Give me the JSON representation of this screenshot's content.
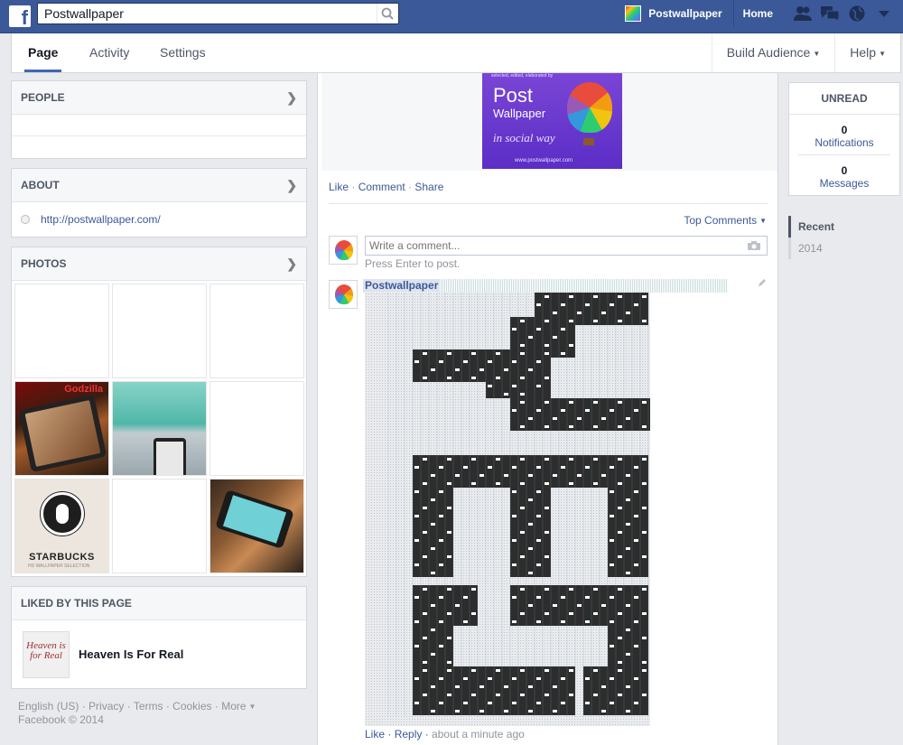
{
  "topbar": {
    "search_value": "Postwallpaper",
    "page_name": "Postwallpaper",
    "home_label": "Home",
    "icons": [
      "friend-requests-icon",
      "messages-icon",
      "notifications-globe-icon",
      "account-menu-icon"
    ]
  },
  "pagenav": {
    "tabs": [
      {
        "label": "Page",
        "active": true
      },
      {
        "label": "Activity",
        "active": false
      },
      {
        "label": "Settings",
        "active": false
      }
    ],
    "build_audience": "Build Audience",
    "help": "Help"
  },
  "left": {
    "people_title": "PEOPLE",
    "about_title": "ABOUT",
    "about_url": "http://postwallpaper.com/",
    "photos_title": "PHOTOS",
    "photos": {
      "godzilla_text": "Godzilla",
      "starbucks_text": "STARBUCKS",
      "wallpaper_selection_text": "HD WALLPAPER SELECTION"
    },
    "liked_title": "LIKED BY THIS PAGE",
    "liked_page_name": "Heaven Is For Real",
    "liked_thumb_text": "Heaven is for Real",
    "footer_links": [
      "English (US)",
      "Privacy",
      "Terms",
      "Cookies",
      "More"
    ],
    "copyright": "Facebook © 2014"
  },
  "post": {
    "banner": {
      "tagline": "selected, edited, elaborated by",
      "title1": "Post",
      "title2": "Wallpaper",
      "subtitle": "in social way",
      "url": "www.postwallpaper.com"
    },
    "actions": [
      "Like",
      "Comment",
      "Share"
    ],
    "top_comments": "Top Comments",
    "comment_placeholder": "Write a comment...",
    "press_enter": "Press Enter to post.",
    "commenter_name": "Postwallpaper",
    "reply_actions": [
      "Like",
      "Reply"
    ],
    "reply_time": "about a minute ago"
  },
  "right": {
    "unread_title": "UNREAD",
    "notifications_count": "0",
    "notifications_label": "Notifications",
    "messages_count": "0",
    "messages_label": "Messages",
    "timeline": [
      {
        "label": "Recent",
        "active": true
      },
      {
        "label": "2014",
        "active": false
      }
    ]
  },
  "colors": {
    "facebook_blue": "#3b5998",
    "link_blue": "#3b5998",
    "page_bg": "#e9eaed",
    "pixel_dark": "#2d2d2d"
  }
}
